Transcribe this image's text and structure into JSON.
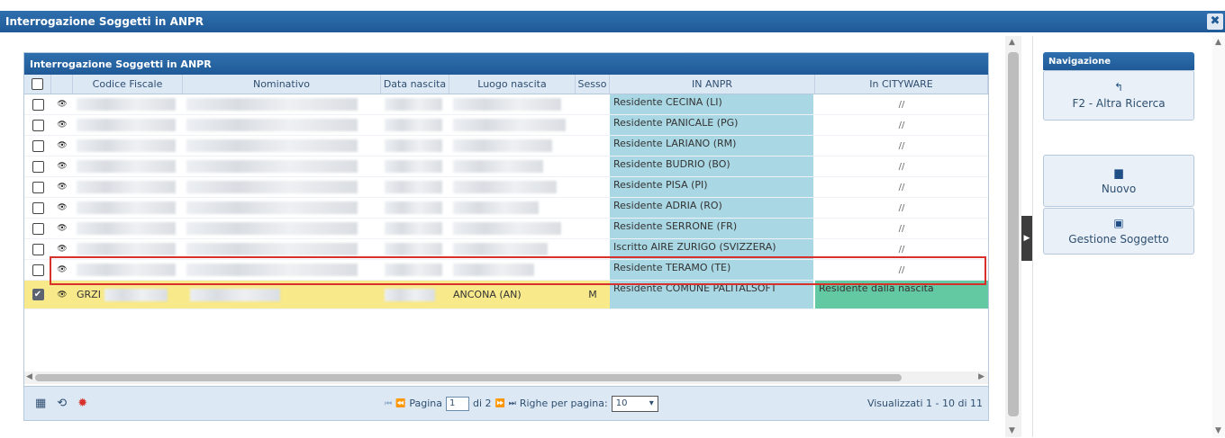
{
  "window": {
    "title": "Interrogazione Soggetti in ANPR",
    "close": "✖"
  },
  "grid": {
    "caption": "Interrogazione Soggetti in ANPR",
    "headers": {
      "codice_fiscale": "Codice Fiscale",
      "nominativo": "Nominativo",
      "data_nascita": "Data nascita",
      "luogo_nascita": "Luogo nascita",
      "sesso": "Sesso",
      "in_anpr": "IN ANPR",
      "in_cityware": "In CITYWARE"
    },
    "rows": [
      {
        "anpr": "Residente CECINA (LI)",
        "cityware": "//"
      },
      {
        "anpr": "Residente PANICALE (PG)",
        "cityware": "//"
      },
      {
        "anpr": "Residente LARIANO (RM)",
        "cityware": "//"
      },
      {
        "anpr": "Residente BUDRIO (BO)",
        "cityware": "//"
      },
      {
        "anpr": "Residente PISA (PI)",
        "cityware": "//"
      },
      {
        "anpr": "Residente ADRIA (RO)",
        "cityware": "//"
      },
      {
        "anpr": "Residente SERRONE (FR)",
        "cityware": "//"
      },
      {
        "anpr": "Iscritto AIRE ZURIGO (SVIZZERA)",
        "cityware": "//"
      },
      {
        "anpr": "Residente TERAMO (TE)",
        "cityware": "//"
      }
    ],
    "selected_row": {
      "codice_fiscale": "GRZI",
      "luogo_nascita": "ANCONA (AN)",
      "sesso": "M",
      "anpr": "Residente COMUNE PALITALSOFT",
      "cityware": "Residente dalla nascita"
    },
    "footer": {
      "pagina_label": "Pagina",
      "page_value": "1",
      "of_pages": "di 2",
      "righe_label": "Righe per pagina:",
      "rows_per_page": "10",
      "summary": "Visualizzati 1 - 10 di 11"
    }
  },
  "navigation": {
    "caption": "Navigazione",
    "buttons": {
      "altra_ricerca": "F2 - Altra Ricerca",
      "nuovo": "Nuovo",
      "gestione": "Gestione Soggetto"
    }
  },
  "colors": {
    "header_blue": "#1f5a97",
    "anpr_cell": "#a9d7e3",
    "selected_row": "#f8e98a",
    "cityware_selected": "#63c9a3",
    "selection_outline": "#d8302b"
  }
}
